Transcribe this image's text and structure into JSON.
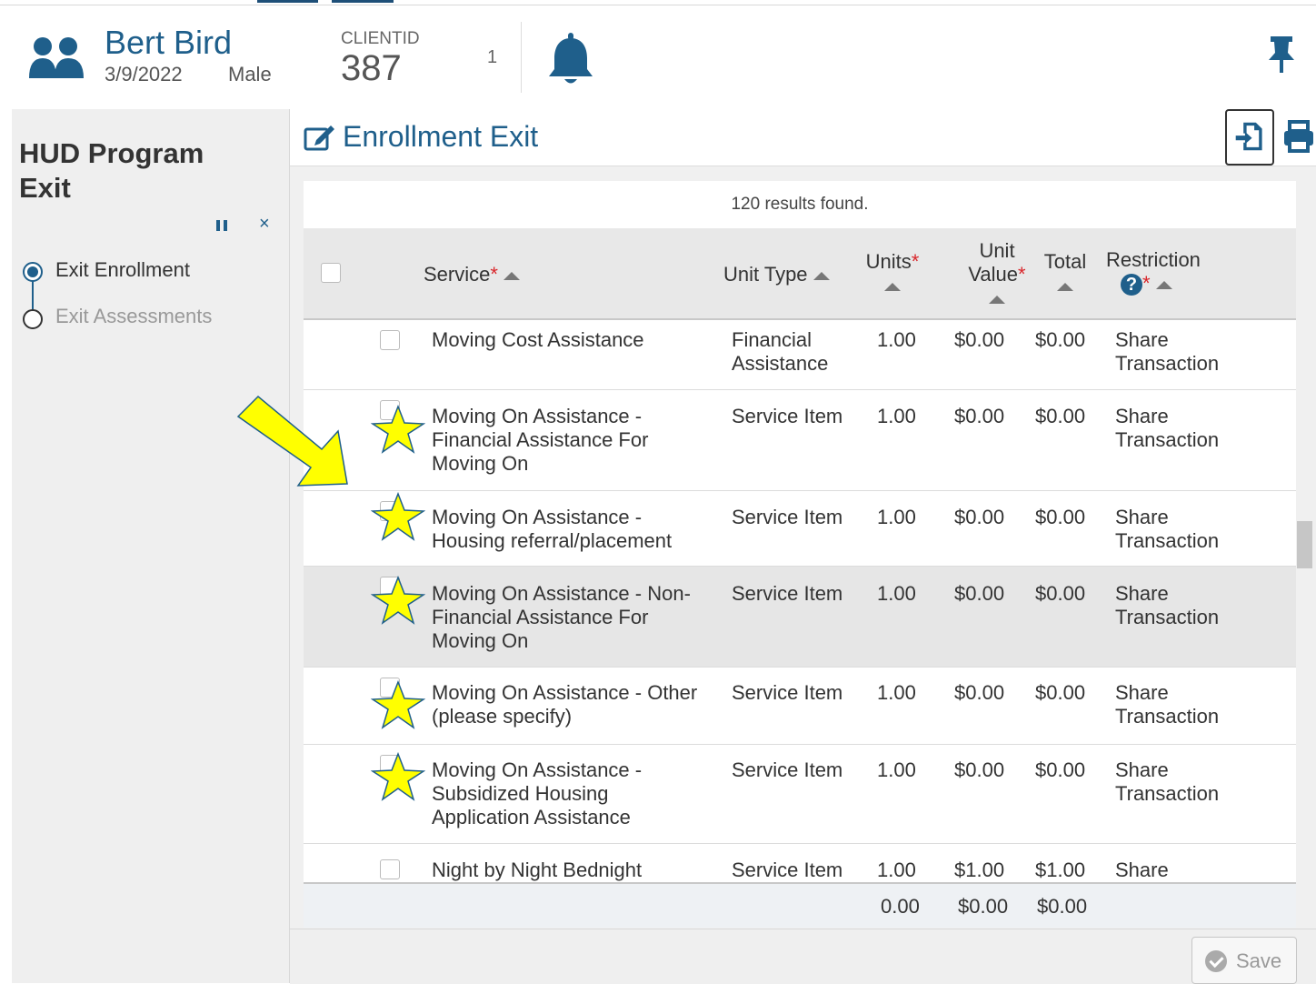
{
  "client": {
    "name": "Bert Bird",
    "dob": "3/9/2022",
    "gender": "Male",
    "id_label": "CLIENTID",
    "id_value": "387",
    "notification_count": "1"
  },
  "sidebar": {
    "title": "HUD Program Exit",
    "close_label": "×",
    "steps": [
      {
        "label": "Exit Enrollment",
        "active": true
      },
      {
        "label": "Exit Assessments",
        "active": false
      }
    ]
  },
  "main": {
    "title": "Enrollment Exit",
    "results_text": "120 results found."
  },
  "table": {
    "headers": {
      "service": "Service",
      "unit_type": "Unit Type",
      "units": "Units",
      "unit_value_1": "Unit",
      "unit_value_2": "Value",
      "total": "Total",
      "restriction": "Restriction",
      "required_mark": "*",
      "help": "?"
    },
    "rows": [
      {
        "service": "Moving Cost Assistance",
        "unit_type": "Financial Assistance",
        "units": "1.00",
        "unit_value": "$0.00",
        "total": "$0.00",
        "restriction": "Share Transaction",
        "starred": false
      },
      {
        "service": "Moving On Assistance - Financial Assistance For Moving On",
        "unit_type": "Service Item",
        "units": "1.00",
        "unit_value": "$0.00",
        "total": "$0.00",
        "restriction": "Share Transaction",
        "starred": true
      },
      {
        "service": "Moving On Assistance - Housing referral/placement",
        "unit_type": "Service Item",
        "units": "1.00",
        "unit_value": "$0.00",
        "total": "$0.00",
        "restriction": "Share Transaction",
        "starred": true
      },
      {
        "service": "Moving On Assistance - Non-Financial Assistance For Moving On",
        "unit_type": "Service Item",
        "units": "1.00",
        "unit_value": "$0.00",
        "total": "$0.00",
        "restriction": "Share Transaction",
        "starred": true,
        "highlighted": true
      },
      {
        "service": "Moving On Assistance - Other (please specify)",
        "unit_type": "Service Item",
        "units": "1.00",
        "unit_value": "$0.00",
        "total": "$0.00",
        "restriction": "Share Transaction",
        "starred": true
      },
      {
        "service": "Moving On Assistance - Subsidized Housing Application Assistance",
        "unit_type": "Service Item",
        "units": "1.00",
        "unit_value": "$0.00",
        "total": "$0.00",
        "restriction": "Share Transaction",
        "starred": true
      },
      {
        "service": "Night by Night Bednight",
        "unit_type": "Service Item",
        "units": "1.00",
        "unit_value": "$1.00",
        "total": "$1.00",
        "restriction": "Share",
        "starred": false
      }
    ],
    "totals": {
      "units": "0.00",
      "unit_value": "$0.00",
      "total": "$0.00"
    }
  },
  "footer": {
    "save_label": "Save"
  },
  "colors": {
    "accent": "#1f5f8b",
    "required": "#d9262b",
    "star": "#ffff00",
    "arrow": "#ffff00"
  },
  "icons": [
    "users-icon",
    "bell-icon",
    "pin-icon",
    "pause-icon",
    "close-icon",
    "edit-icon",
    "export-icon",
    "print-icon",
    "help-icon",
    "check-circle-icon",
    "star-icon",
    "arrow-annotation-icon"
  ]
}
